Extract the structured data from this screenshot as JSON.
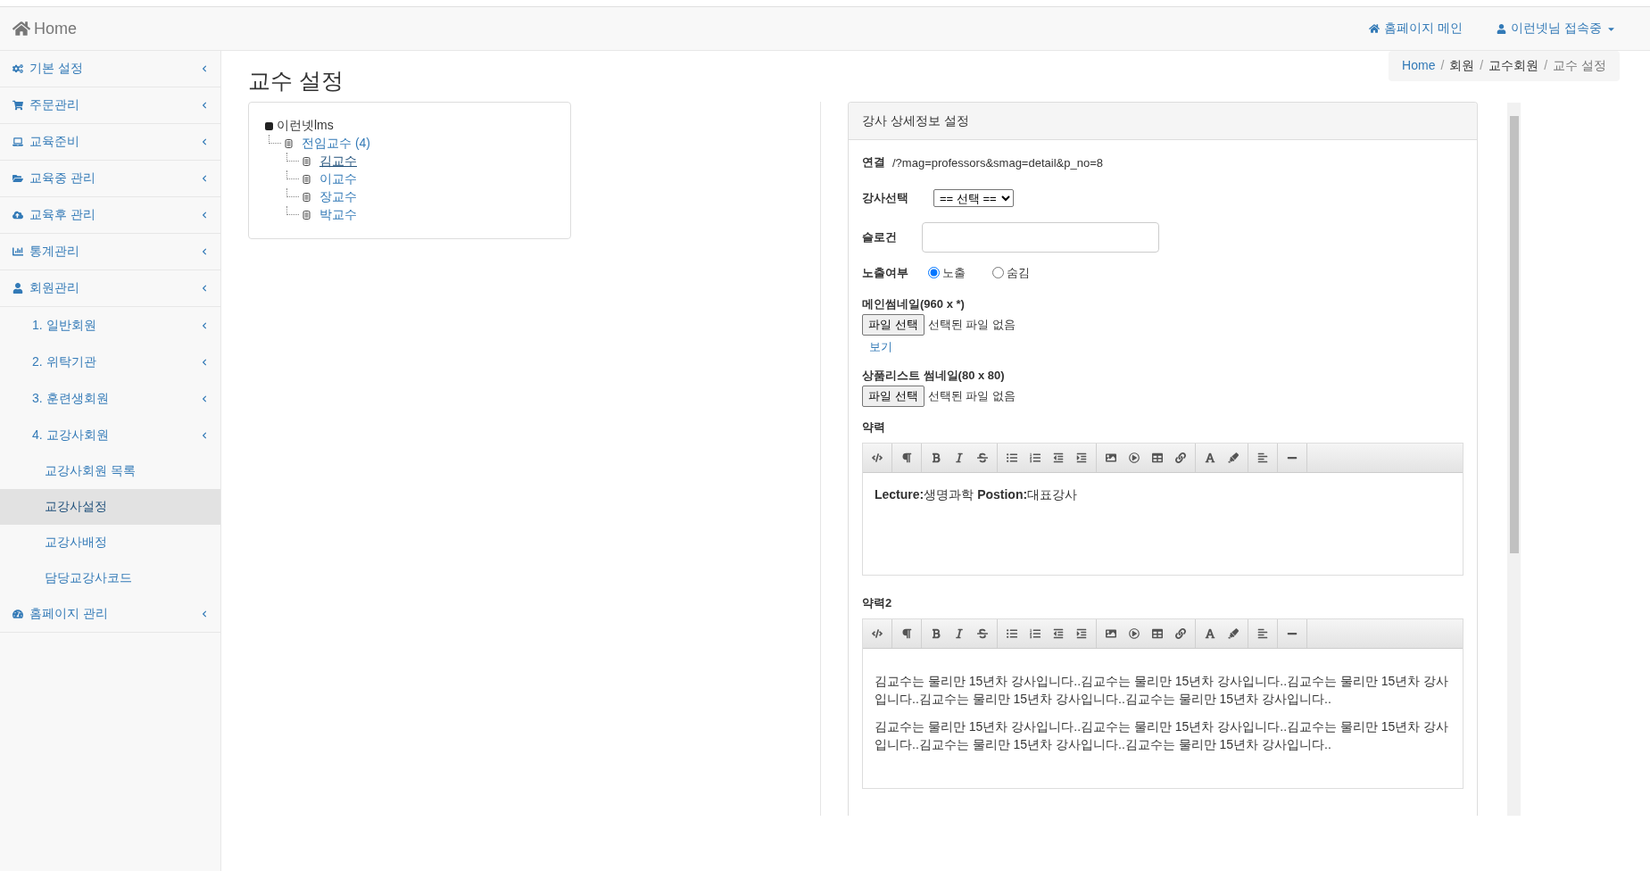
{
  "topbar": {
    "brand": "Home",
    "links": [
      {
        "kind": "home",
        "label": "홈페이지 메인"
      },
      {
        "kind": "user",
        "label": "이런넷님 접속중"
      }
    ]
  },
  "sidebar": {
    "items": [
      {
        "kind": "gears",
        "label": "기본 설정",
        "selected": false
      },
      {
        "kind": "cart",
        "label": "주문관리",
        "selected": false
      },
      {
        "kind": "laptop",
        "label": "교육준비",
        "selected": false
      },
      {
        "kind": "folder",
        "label": "교육중 관리",
        "selected": false
      },
      {
        "kind": "cloud",
        "label": "교육후 관리",
        "selected": false
      },
      {
        "kind": "chart",
        "label": "통계관리",
        "selected": false
      },
      {
        "kind": "user",
        "label": "회원관리",
        "selected": false,
        "children": [
          {
            "label": "1. 일반회원",
            "selected": false
          },
          {
            "label": "2. 위탁기관",
            "selected": false
          },
          {
            "label": "3. 훈련생회원",
            "selected": false
          },
          {
            "label": "4. 교강사회원",
            "selected": false,
            "children": [
              {
                "label": "교강사회원 목록",
                "selected": false
              },
              {
                "label": "교강사설정",
                "selected": true
              },
              {
                "label": "교강사배정",
                "selected": false
              },
              {
                "label": "담당교강사코드",
                "selected": false
              }
            ]
          }
        ]
      },
      {
        "kind": "gauge",
        "label": "홈페이지 관리",
        "selected": false
      }
    ]
  },
  "page_title": "교수 설정",
  "breadcrumb": [
    {
      "kind": "link",
      "label": "Home"
    },
    {
      "kind": "separator",
      "label": "/"
    },
    {
      "kind": "text",
      "label": "회원"
    },
    {
      "kind": "separator",
      "label": "/"
    },
    {
      "kind": "text",
      "label": "교수회원"
    },
    {
      "kind": "separator",
      "label": "/"
    },
    {
      "kind": "active",
      "label": "교수 설정"
    }
  ],
  "tree": {
    "label": "이런넷lms",
    "children": [
      {
        "label": "전임교수 (4)",
        "selected": false,
        "children": [
          {
            "label": "김교수",
            "selected": true
          },
          {
            "label": "이교수",
            "selected": false
          },
          {
            "label": "장교수",
            "selected": false
          },
          {
            "label": "박교수",
            "selected": false
          }
        ]
      }
    ]
  },
  "detail_panel": {
    "title": "강사 상세정보 설정",
    "fields": [
      {
        "kind": "link",
        "label": "연결",
        "value": "/?mag=professors&smag=detail&p_no=8"
      },
      {
        "kind": "select",
        "label": "강사선택",
        "value": "== 선택 =="
      },
      {
        "kind": "input",
        "label": "슬로건"
      },
      {
        "kind": "radio",
        "label": "노출여부",
        "options": [
          {
            "label": "노출",
            "selected": true
          },
          {
            "label": "숨김",
            "selected": false
          }
        ]
      },
      {
        "kind": "file",
        "label": "메인썸네일(960 x *)",
        "button": "파일 선택",
        "status": "선택된 파일 없음",
        "link": "보기"
      },
      {
        "kind": "file",
        "label": "상품리스트 썸네일(80 x 80)",
        "button": "파일 선택",
        "status": "선택된 파일 없음"
      },
      {
        "kind": "editor",
        "label": "약력",
        "paragraphs": [
          "**Lecture:**생명과학 **Postion:**대표강사"
        ]
      },
      {
        "kind": "editor",
        "label": "약력2",
        "paragraphs": [
          "김교수는 물리만 15년차 강사입니다..김교수는 물리만 15년차 강사입니다..김교수는 물리만 15년차 강사입니다..김교수는 물리만 15년차 강사입니다..김교수는 물리만 15년차 강사입니다..",
          "김교수는 물리만 15년차 강사입니다..김교수는 물리만 15년차 강사입니다..김교수는 물리만 15년차 강사입니다..김교수는 물리만 15년차 강사입니다..김교수는 물리만 15년차 강사입니다.."
        ]
      }
    ]
  }
}
